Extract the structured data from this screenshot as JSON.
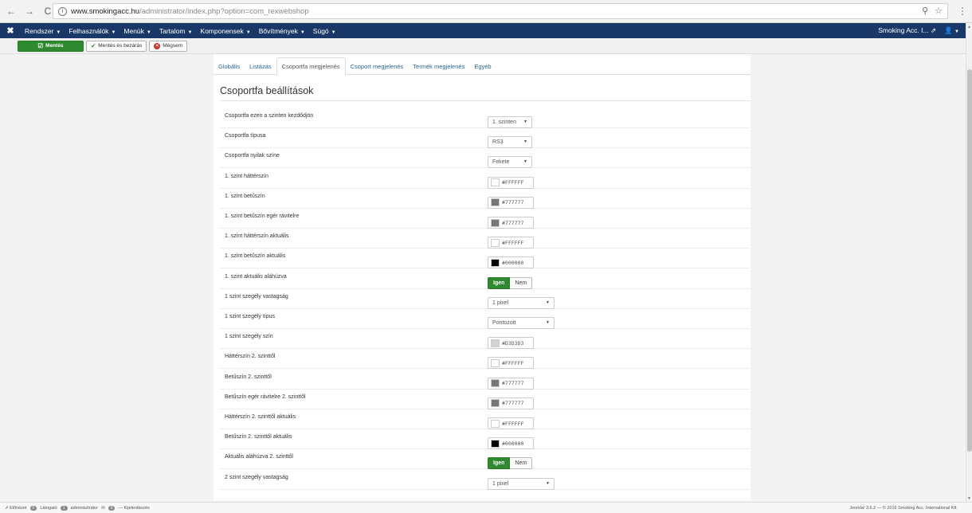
{
  "browser": {
    "url_host": "www.smokingacc.hu",
    "url_path": "/administrator/index.php?option=com_rexwebshop"
  },
  "adminbar": {
    "menu": [
      "Rendszer",
      "Felhasználók",
      "Menük",
      "Tartalom",
      "Komponensek",
      "Bővítmények",
      "Súgó"
    ],
    "site_name": "Smoking Acc. I...",
    "user_icon": "user-icon"
  },
  "toolbar": {
    "save": "Mentés",
    "save_close": "Mentés és bezárás",
    "cancel": "Mégsem"
  },
  "tabs": [
    "Globális",
    "Listázás",
    "Csoportfa megjelenés",
    "Csoport megjelenés",
    "Termék megjelenés",
    "Egyéb"
  ],
  "page_title": "Csoportfa beállítások",
  "rows": [
    {
      "label": "Csoportfa ezen a szinten kezdődjön",
      "type": "select",
      "value": "1. szinten"
    },
    {
      "label": "Csoportfa típusa",
      "type": "select",
      "value": "RS3"
    },
    {
      "label": "Csoportfa nyilak színe",
      "type": "select",
      "value": "Fekete"
    },
    {
      "label": "1. szint háttérszín",
      "type": "color",
      "value": "#FFFFFF",
      "swatch": "#FFFFFF"
    },
    {
      "label": "1. szint betűszín",
      "type": "color",
      "value": "#777777",
      "swatch": "#777777"
    },
    {
      "label": "1. szint betűszín egér rávitelre",
      "type": "color",
      "value": "#777777",
      "swatch": "#777777"
    },
    {
      "label": "1. szint háttérszín aktuális",
      "type": "color",
      "value": "#FFFFFF",
      "swatch": "#FFFFFF"
    },
    {
      "label": "1. szint betűszín aktuális",
      "type": "color",
      "value": "#000000",
      "swatch": "#000000"
    },
    {
      "label": "1. szint aktuális aláhúzva",
      "type": "toggle",
      "on": "Igen",
      "off": "Nem"
    },
    {
      "label": "1 szint szegély vastagság",
      "type": "select",
      "value": "1 pixel"
    },
    {
      "label": "1 szint szegély típus",
      "type": "select",
      "value": "Pontozott"
    },
    {
      "label": "1 szint szegély szín",
      "type": "color",
      "value": "#D3D3D3",
      "swatch": "#D3D3D3"
    },
    {
      "label": "Háttérszín 2. szinttől",
      "type": "color",
      "value": "#FFFFFF",
      "swatch": "#FFFFFF"
    },
    {
      "label": "Betűszín 2. szinttől",
      "type": "color",
      "value": "#777777",
      "swatch": "#777777"
    },
    {
      "label": "Betűszín egér rávitelre 2. szinttől",
      "type": "color",
      "value": "#777777",
      "swatch": "#777777"
    },
    {
      "label": "Háttérszín 2. szinttől aktuális",
      "type": "color",
      "value": "#FFFFFF",
      "swatch": "#FFFFFF"
    },
    {
      "label": "Betűszín 2. szinttől aktuális",
      "type": "color",
      "value": "#000000",
      "swatch": "#000000"
    },
    {
      "label": "Aktuális aláhúzva 2. szinttől",
      "type": "toggle",
      "on": "Igen",
      "off": "Nem"
    },
    {
      "label": "2 szint szegély vastagság",
      "type": "select",
      "value": "1 pixel"
    }
  ],
  "statusbar": {
    "preview": "Előnézet",
    "visitors_count": "0",
    "visitors": "Látogató",
    "admins_count": "1",
    "admin": "adminisztrátor",
    "messages_count": "0",
    "logout": "Kijelentkezés",
    "footer": "Joomla! 3.6.2 — © 2016 Smoking Acc. International Kft."
  },
  "colors": {
    "brand_nav": "#1a3867",
    "success": "#2f8a2f",
    "link": "#2a6496"
  }
}
